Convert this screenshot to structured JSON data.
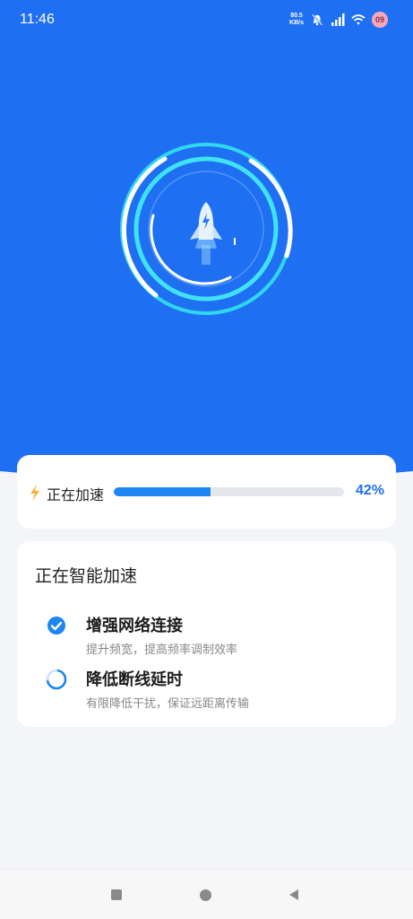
{
  "status_bar": {
    "time": "11:46",
    "speed_value": "80.5",
    "speed_unit": "KB/s",
    "battery_level": "09"
  },
  "hero": {
    "icon": "rocket-icon"
  },
  "progress": {
    "label": "正在加速",
    "percent": 42,
    "percent_label": "42%",
    "icon": "lightning-icon",
    "accent_color": "#1f6ff2"
  },
  "task": {
    "title": "正在智能加速",
    "items": [
      {
        "name": "增强网络连接",
        "description": "提升频宽，提高频率调制效率",
        "status": "done",
        "icon": "check-circle-icon"
      },
      {
        "name": "降低断线延时",
        "description": "有限降低干扰，保证远距离传输",
        "status": "loading",
        "icon": "spinner-icon"
      }
    ]
  },
  "nav": {
    "recent_icon": "square-icon",
    "home_icon": "circle-icon",
    "back_icon": "back-triangle-icon"
  }
}
